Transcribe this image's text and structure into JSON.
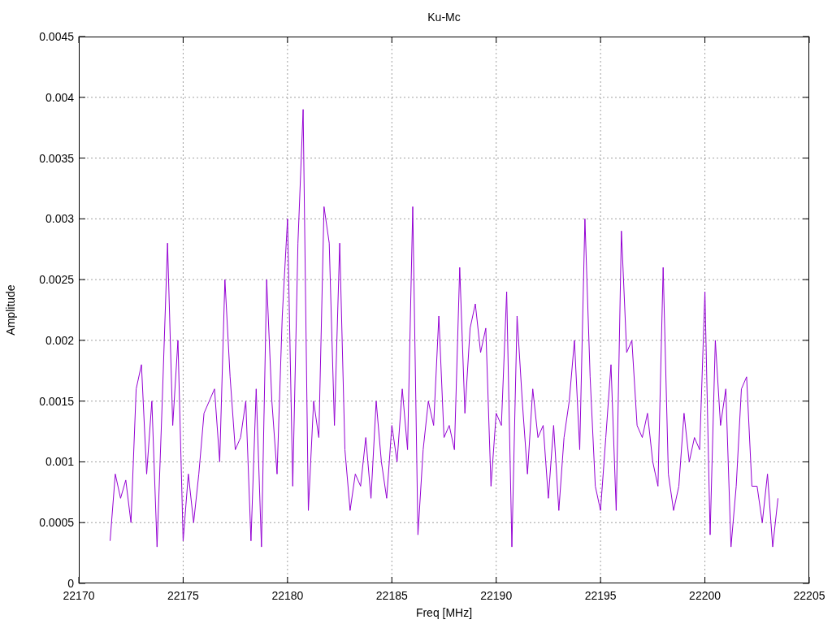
{
  "chart_data": {
    "type": "line",
    "title": "Ku-Mc",
    "xlabel": "Freq [MHz]",
    "ylabel": "Amplitude",
    "grid": true,
    "xlim": [
      22170,
      22205
    ],
    "ylim": [
      0,
      0.0045
    ],
    "xticks": [
      22170,
      22175,
      22180,
      22185,
      22190,
      22195,
      22200,
      22205
    ],
    "yticks": [
      {
        "value": 0,
        "label": "0"
      },
      {
        "value": 0.0005,
        "label": "0.0005"
      },
      {
        "value": 0.001,
        "label": "0.001"
      },
      {
        "value": 0.0015,
        "label": "0.0015"
      },
      {
        "value": 0.002,
        "label": "0.002"
      },
      {
        "value": 0.0025,
        "label": "0.0025"
      },
      {
        "value": 0.003,
        "label": "0.003"
      },
      {
        "value": 0.0035,
        "label": "0.0035"
      },
      {
        "value": 0.004,
        "label": "0.004"
      },
      {
        "value": 0.0045,
        "label": "0.0045"
      }
    ],
    "x": [
      22171.5,
      22171.75,
      22172,
      22172.25,
      22172.5,
      22172.75,
      22173,
      22173.25,
      22173.5,
      22173.75,
      22174,
      22174.25,
      22174.5,
      22174.75,
      22175,
      22175.25,
      22175.5,
      22175.75,
      22176,
      22176.25,
      22176.5,
      22176.75,
      22177,
      22177.25,
      22177.5,
      22177.75,
      22178,
      22178.25,
      22178.5,
      22178.75,
      22179,
      22179.25,
      22179.5,
      22179.75,
      22180,
      22180.25,
      22180.5,
      22180.75,
      22181,
      22181.25,
      22181.5,
      22181.75,
      22182,
      22182.25,
      22182.5,
      22182.75,
      22183,
      22183.25,
      22183.5,
      22183.75,
      22184,
      22184.25,
      22184.5,
      22184.75,
      22185,
      22185.25,
      22185.5,
      22185.75,
      22186,
      22186.25,
      22186.5,
      22186.75,
      22187,
      22187.25,
      22187.5,
      22187.75,
      22188,
      22188.25,
      22188.5,
      22188.75,
      22189,
      22189.25,
      22189.5,
      22189.75,
      22190,
      22190.25,
      22190.5,
      22190.75,
      22191,
      22191.25,
      22191.5,
      22191.75,
      22192,
      22192.25,
      22192.5,
      22192.75,
      22193,
      22193.25,
      22193.5,
      22193.75,
      22194,
      22194.25,
      22194.5,
      22194.75,
      22195,
      22195.25,
      22195.5,
      22195.75,
      22196,
      22196.25,
      22196.5,
      22196.75,
      22197,
      22197.25,
      22197.5,
      22197.75,
      22198,
      22198.25,
      22198.5,
      22198.75,
      22199,
      22199.25,
      22199.5,
      22199.75,
      22200,
      22200.25,
      22200.5,
      22200.75,
      22201,
      22201.25,
      22201.5,
      22201.75,
      22202,
      22202.25,
      22202.5,
      22202.75,
      22203,
      22203.25,
      22203.5
    ],
    "series": [
      {
        "color": "#9400d3",
        "values": [
          0.00035,
          0.0009,
          0.0007,
          0.00085,
          0.0005,
          0.0016,
          0.0018,
          0.0009,
          0.0015,
          0.0003,
          0.0015,
          0.0028,
          0.0013,
          0.002,
          0.00035,
          0.0009,
          0.0005,
          0.0009,
          0.0014,
          0.0015,
          0.0016,
          0.001,
          0.0025,
          0.0017,
          0.0011,
          0.0012,
          0.0015,
          0.00035,
          0.0016,
          0.0003,
          0.0025,
          0.0015,
          0.0009,
          0.0022,
          0.003,
          0.0008,
          0.0028,
          0.0039,
          0.0006,
          0.0015,
          0.0012,
          0.0031,
          0.0028,
          0.0013,
          0.0028,
          0.0011,
          0.0006,
          0.0009,
          0.0008,
          0.0012,
          0.0007,
          0.0015,
          0.001,
          0.0007,
          0.0013,
          0.001,
          0.0016,
          0.0011,
          0.0031,
          0.0004,
          0.0011,
          0.0015,
          0.0013,
          0.0022,
          0.0012,
          0.0013,
          0.0011,
          0.0026,
          0.0014,
          0.0021,
          0.0023,
          0.0019,
          0.0021,
          0.0008,
          0.0014,
          0.0013,
          0.0024,
          0.0003,
          0.0022,
          0.0015,
          0.0009,
          0.0016,
          0.0012,
          0.0013,
          0.0007,
          0.0013,
          0.0006,
          0.0012,
          0.0015,
          0.002,
          0.0011,
          0.003,
          0.0017,
          0.0008,
          0.0006,
          0.0012,
          0.0018,
          0.0006,
          0.0029,
          0.0019,
          0.002,
          0.0013,
          0.0012,
          0.0014,
          0.001,
          0.0008,
          0.0026,
          0.0009,
          0.0006,
          0.0008,
          0.0014,
          0.001,
          0.0012,
          0.0011,
          0.0024,
          0.0004,
          0.002,
          0.0013,
          0.0016,
          0.0003,
          0.0008,
          0.0016,
          0.0017,
          0.0008,
          0.0008,
          0.0005,
          0.0009,
          0.0003,
          0.0007
        ]
      }
    ]
  }
}
